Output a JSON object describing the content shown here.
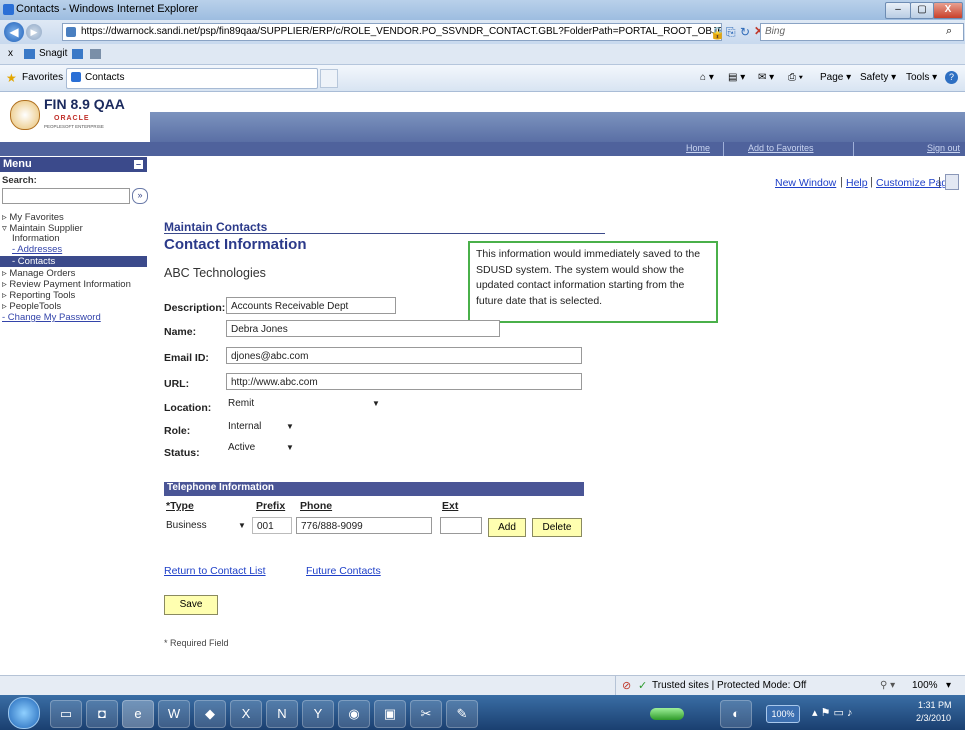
{
  "window": {
    "title": "Contacts - Windows Internet Explorer",
    "min": "–",
    "max": "▢",
    "close": "X"
  },
  "browser": {
    "url": "https://dwarnock.sandi.net/psp/fin89qaa/SUPPLIER/ERP/c/ROLE_VENDOR.PO_SSVNDR_CONTACT.GBL?FolderPath=PORTAL_ROOT_OBJECT.",
    "search_placeholder": "Bing",
    "toolbar2": {
      "close": "x",
      "snagit": "Snagit"
    },
    "favorites": "Favorites",
    "tab": "Contacts",
    "cmd": {
      "page": "Page ▾",
      "safety": "Safety ▾",
      "tools": "Tools ▾"
    }
  },
  "ps_header": {
    "logo_title": "FIN 8.9 QAA",
    "logo_sub": "ORACLE",
    "logo_sub2": "PEOPLESOFT ENTERPRISE",
    "links": {
      "home": "Home",
      "favorites": "Add to Favorites",
      "signout": "Sign out"
    }
  },
  "menu": {
    "title": "Menu",
    "search_label": "Search:",
    "search_btn": "»",
    "items": [
      {
        "label": "My Favorites"
      },
      {
        "label": "Maintain Supplier"
      },
      {
        "label": "Information"
      },
      {
        "label": "- Addresses"
      },
      {
        "label": "- Contacts"
      },
      {
        "label": "Manage Orders"
      },
      {
        "label": "Review Payment Information"
      },
      {
        "label": "Reporting Tools"
      },
      {
        "label": "PeopleTools"
      },
      {
        "label": "- Change My Password"
      }
    ]
  },
  "pagebar": {
    "new_window": "New Window",
    "help": "Help",
    "customize": "Customize Page"
  },
  "page": {
    "section": "Maintain Contacts",
    "heading": "Contact Information",
    "company": "ABC Technologies"
  },
  "callout": {
    "text": "This information would immediately saved to the SDUSD system. The system would show the updated contact information starting from the future date that is selected."
  },
  "form": {
    "description": {
      "label": "Description:",
      "value": "Accounts Receivable Dept"
    },
    "name": {
      "label": "Name:",
      "value": "Debra Jones"
    },
    "email": {
      "label": "Email ID:",
      "value": "djones@abc.com"
    },
    "url": {
      "label": "URL:",
      "value": "http://www.abc.com"
    },
    "location": {
      "label": "Location:",
      "value": "Remit"
    },
    "role": {
      "label": "Role:",
      "value": "Internal"
    },
    "status": {
      "label": "Status:",
      "value": "Active"
    }
  },
  "phone": {
    "header": "Telephone Information",
    "cols": {
      "type": "*Type",
      "prefix": "Prefix",
      "phone": "Phone",
      "ext": "Ext"
    },
    "row": {
      "type": "Business",
      "prefix": "001",
      "phone": "776/888-9099",
      "ext": ""
    },
    "add": "Add",
    "delete": "Delete"
  },
  "links": {
    "return": "Return to Contact List",
    "future": "Future Contacts"
  },
  "save": "Save",
  "required": "* Required Field",
  "statusbar": {
    "zone": "Trusted sites | Protected Mode: Off",
    "zoom": "100%"
  },
  "taskbar": {
    "time": "1:31 PM",
    "date": "2/3/2010",
    "battery": "100%"
  }
}
